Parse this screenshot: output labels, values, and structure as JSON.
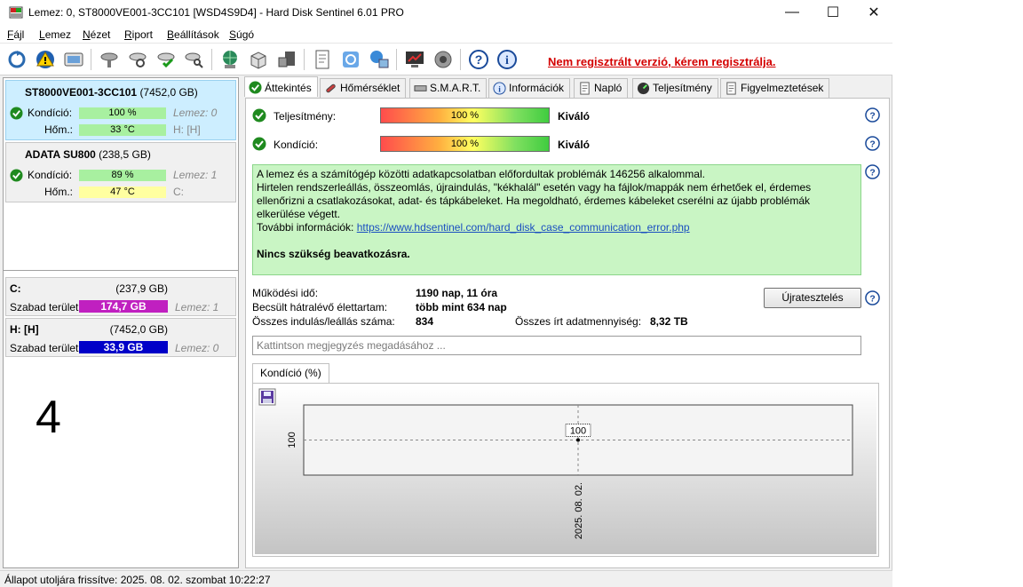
{
  "window": {
    "title": "Lemez: 0, ST8000VE001-3CC101 [WSD4S9D4]  -  Hard Disk Sentinel 6.01 PRO",
    "controls": {
      "minimize": "—",
      "maximize": "☐",
      "close": "✕"
    }
  },
  "menu": [
    "Fájl",
    "Lemez",
    "Nézet",
    "Riport",
    "Beállítások",
    "Súgó"
  ],
  "toolbar": {
    "icons": [
      "refresh-icon",
      "alert-icon",
      "disk-icon",
      "disk-wrench-icon",
      "disk-test-icon",
      "disk-check-icon",
      "disk-search-icon",
      "globe-icon",
      "server-icon",
      "network-icon",
      "report-icon",
      "sync-icon",
      "web-icon",
      "monitor-icon",
      "speaker-icon",
      "help-icon",
      "info-icon"
    ],
    "registration": "Nem regisztrált verzió, kérem regisztrálja."
  },
  "disks": [
    {
      "name": "ST8000VE001-3CC101",
      "size": "(7452,0 GB)",
      "condition_label": "Kondíció:",
      "condition_value": "100 %",
      "condition": 100,
      "side1": "Lemez: 0",
      "temp_label": "Hőm.:",
      "temp_value": "33 °C",
      "side2": "H: [H]"
    },
    {
      "name": "ADATA SU800",
      "size": "(238,5 GB)",
      "condition_label": "Kondíció:",
      "condition_value": "89 %",
      "condition": 89,
      "side1": "Lemez: 1",
      "temp_label": "Hőm.:",
      "temp_value": "47 °C",
      "side2": "C:"
    }
  ],
  "volumes": [
    {
      "name": "C:",
      "size": "(237,9 GB)",
      "free_label": "Szabad terület",
      "free": "174,7 GB",
      "disk": "Lemez: 1",
      "color": "#c020c0"
    },
    {
      "name": "H: [H]",
      "size": "(7452,0 GB)",
      "free_label": "Szabad terület",
      "free": "33,9 GB",
      "disk": "Lemez: 0",
      "color": "#0000c8"
    }
  ],
  "big_number": "4",
  "tabs": [
    "Áttekintés",
    "Hőmérséklet",
    "S.M.A.R.T.",
    "Információk",
    "Napló",
    "Teljesítmény",
    "Figyelmeztetések"
  ],
  "overview": {
    "performance_label": "Teljesítmény:",
    "performance_value": "100 %",
    "performance": 100,
    "performance_rating": "Kiváló",
    "condition_label": "Kondíció:",
    "condition_value": "100 %",
    "condition": 100,
    "condition_rating": "Kiváló",
    "message_line1": "A lemez és a számítógép közötti adatkapcsolatban előfordultak problémák 146256 alkalommal.",
    "message_line2": "Hirtelen rendszerleállás, összeomlás, újraindulás, \"kékhalál\" esetén vagy ha fájlok/mappák nem érhetőek el, érdemes ellenőrizni a csatlakozásokat, adat- és tápkábeleket. Ha megoldható, érdemes kábeleket cserélni az újabb problémák elkerülése végett.",
    "more_info_label": "További információk:",
    "more_info_link": "https://www.hdsentinel.com/hard_disk_case_communication_error.php",
    "action": "Nincs szükség beavatkozásra.",
    "uptime_label": "Működési idő:",
    "uptime_value": "1190 nap, 11 óra",
    "remaining_label": "Becsült hátralévő élettartam:",
    "remaining_value": "több mint 634 nap",
    "startstop_label": "Összes indulás/leállás száma:",
    "startstop_value": "834",
    "written_label": "Összes írt adatmennyiség:",
    "written_value": "8,32 TB",
    "reset_button": "Újratesztelés",
    "note_placeholder": "Kattintson megjegyzés megadásához ..."
  },
  "chart_tab": "Kondíció  (%)",
  "chart_data": {
    "type": "line",
    "x": [
      "2025. 08. 02."
    ],
    "series": [
      {
        "values": [
          100
        ]
      }
    ],
    "ylabel": "",
    "y_tick": "100",
    "point_label": "100",
    "ylim": [
      0,
      200
    ],
    "grid": true
  },
  "status": "Állapot utoljára frissítve: 2025. 08. 02. szombat 10:22:27"
}
